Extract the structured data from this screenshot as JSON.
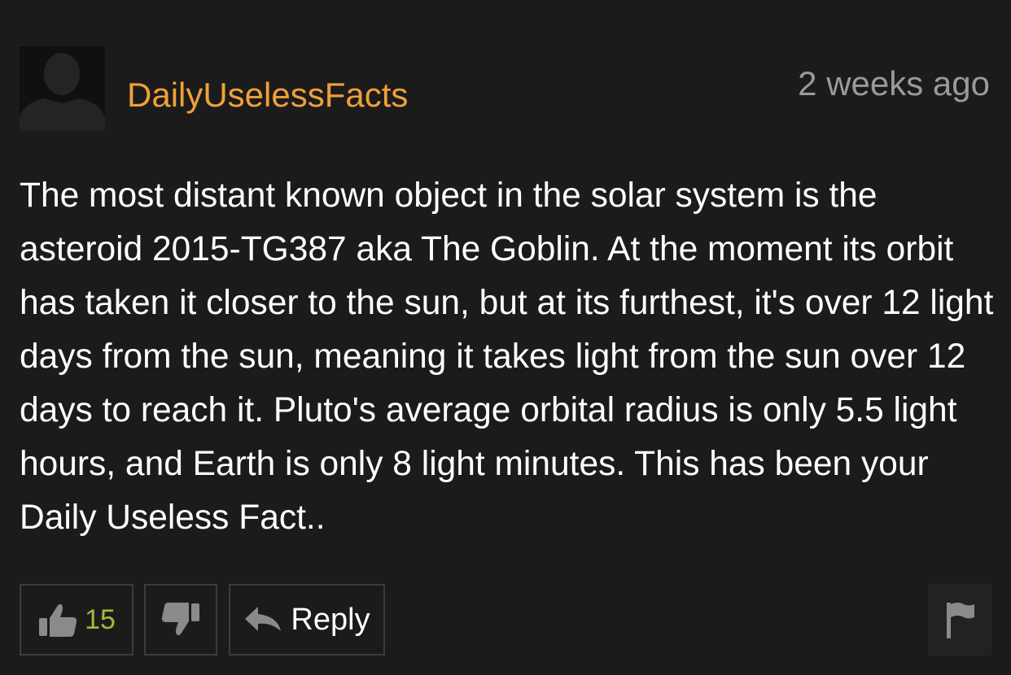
{
  "comment": {
    "username": "DailyUselessFacts",
    "timestamp": "2 weeks ago",
    "text": "The most distant known object in the solar system is the asteroid 2015-TG387 aka The Goblin. At the moment its orbit has taken it closer to the sun, but at its furthest, it's over 12 light days from the sun, meaning it takes light from the sun over 12 days to reach it. Pluto's average orbital radius is only 5.5 light hours, and Earth is only 8 light minutes. This has been your Daily Useless Fact..",
    "likes": "15",
    "reply_label": "Reply"
  },
  "icons": {
    "avatar": "default-user-silhouette",
    "like": "thumbs-up-icon",
    "dislike": "thumbs-down-icon",
    "reply": "reply-arrow-icon",
    "flag": "flag-icon"
  },
  "colors": {
    "background": "#1b1b1b",
    "username": "#f0a03a",
    "timestamp": "#9a9a9a",
    "text": "#ffffff",
    "like_count": "#a8b83a",
    "button_border": "#3c3c3c"
  }
}
